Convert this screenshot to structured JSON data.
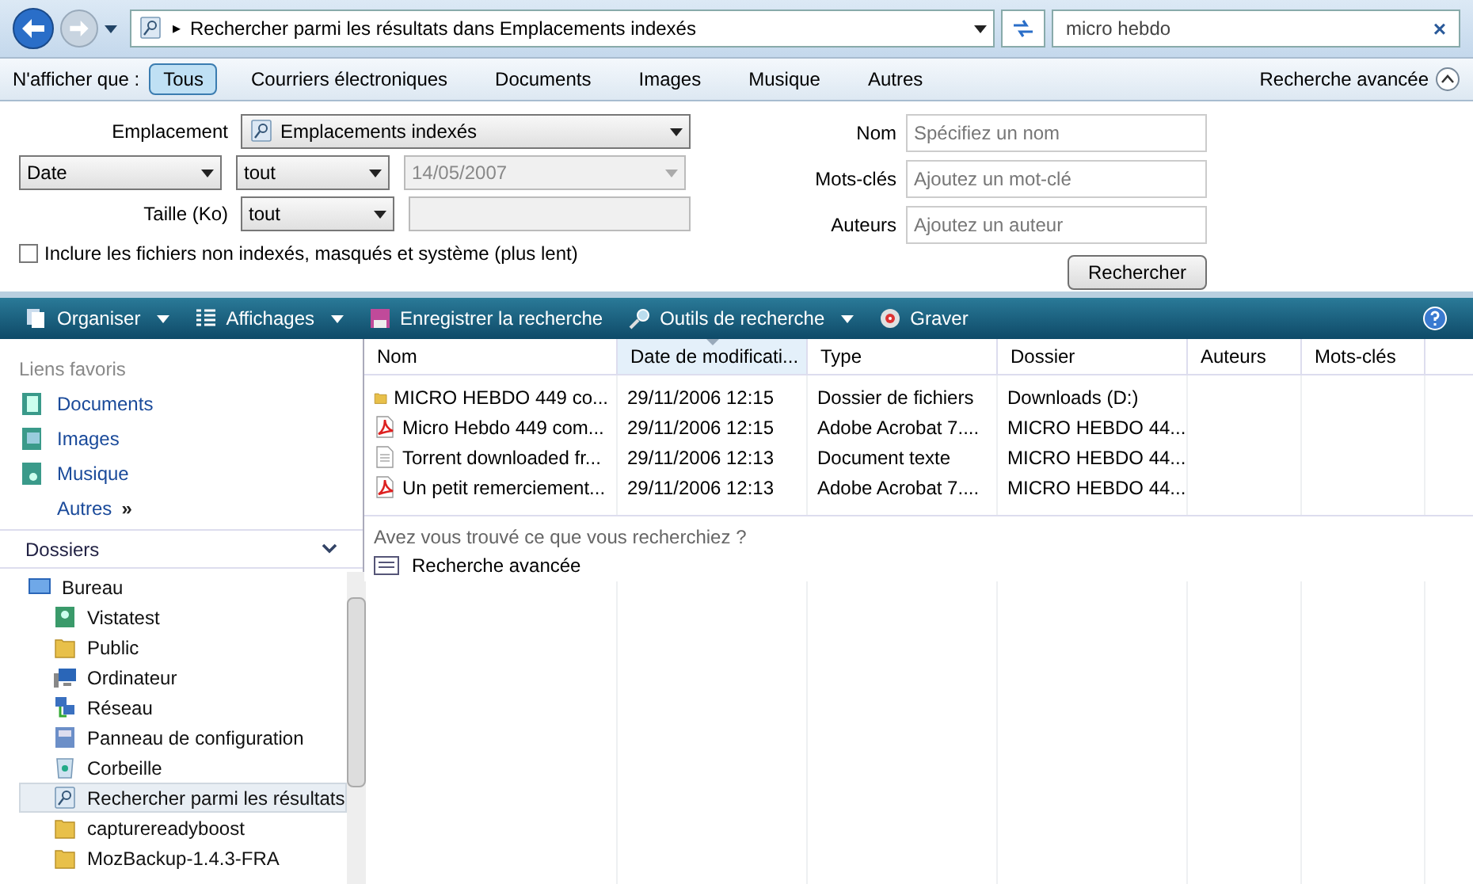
{
  "address_bar": {
    "path_arrow": "▸",
    "path": "Rechercher parmi les résultats dans Emplacements indexés",
    "search_value": "micro hebdo",
    "clear": "×"
  },
  "filter_bar": {
    "label": "N'afficher que :",
    "filters": [
      {
        "label": "Tous",
        "selected": true
      },
      {
        "label": "Courriers électroniques",
        "selected": false
      },
      {
        "label": "Documents",
        "selected": false
      },
      {
        "label": "Images",
        "selected": false
      },
      {
        "label": "Musique",
        "selected": false
      },
      {
        "label": "Autres",
        "selected": false
      }
    ],
    "advanced": "Recherche avancée"
  },
  "advanced_search": {
    "location_label": "Emplacement",
    "location": "Emplacements indexés",
    "date_field": "Date",
    "date_op": "tout",
    "date_value": "14/05/2007",
    "size_label": "Taille (Ko)",
    "size_op": "tout",
    "include_label": "Inclure les fichiers non indexés, masqués et système (plus lent)",
    "include_checked": false,
    "fields": [
      {
        "label": "Nom",
        "placeholder": "Spécifiez un nom"
      },
      {
        "label": "Mots-clés",
        "placeholder": "Ajoutez un mot-clé"
      },
      {
        "label": "Auteurs",
        "placeholder": "Ajoutez un auteur"
      }
    ],
    "search_button": "Rechercher"
  },
  "toolbar": [
    {
      "label": "Organiser",
      "kind": "organize",
      "dropdown": true
    },
    {
      "label": "Affichages",
      "kind": "views",
      "dropdown": true
    },
    {
      "label": "Enregistrer la recherche",
      "kind": "save",
      "dropdown": false
    },
    {
      "label": "Outils de recherche",
      "kind": "tools",
      "dropdown": true
    },
    {
      "label": "Graver",
      "kind": "burn",
      "dropdown": false
    }
  ],
  "sidebar": {
    "favorites_title": "Liens favoris",
    "favorites": [
      {
        "label": "Documents",
        "kind": "documents"
      },
      {
        "label": "Images",
        "kind": "images"
      },
      {
        "label": "Musique",
        "kind": "music"
      }
    ],
    "more": "Autres",
    "more_arrow": "»",
    "folders_title": "Dossiers",
    "tree": [
      {
        "label": "Bureau",
        "kind": "desktop",
        "selected": false,
        "children": [
          {
            "label": "Vistatest",
            "kind": "user",
            "selected": false
          },
          {
            "label": "Public",
            "kind": "folder",
            "selected": false
          },
          {
            "label": "Ordinateur",
            "kind": "computer",
            "selected": false
          },
          {
            "label": "Réseau",
            "kind": "network",
            "selected": false
          },
          {
            "label": "Panneau de configuration",
            "kind": "control",
            "selected": false
          },
          {
            "label": "Corbeille",
            "kind": "bin",
            "selected": false
          },
          {
            "label": "Rechercher parmi les résultats",
            "kind": "search",
            "selected": true
          },
          {
            "label": "capturereadyboost",
            "kind": "folder",
            "selected": false
          },
          {
            "label": "MozBackup-1.4.3-FRA",
            "kind": "folder",
            "selected": false
          }
        ]
      }
    ]
  },
  "table": {
    "columns": [
      {
        "label": "Nom",
        "sorted": false
      },
      {
        "label": "Date de modificati...",
        "sorted": true
      },
      {
        "label": "Type",
        "sorted": false
      },
      {
        "label": "Dossier",
        "sorted": false
      },
      {
        "label": "Auteurs",
        "sorted": false
      },
      {
        "label": "Mots-clés",
        "sorted": false
      }
    ],
    "rows": [
      {
        "kind": "folder",
        "cells": [
          "MICRO HEBDO 449 co...",
          "29/11/2006 12:15",
          "Dossier de fichiers",
          "Downloads (D:)"
        ]
      },
      {
        "kind": "pdf",
        "cells": [
          "Micro Hebdo 449 com...",
          "29/11/2006 12:15",
          "Adobe Acrobat 7....",
          "MICRO HEBDO 44..."
        ]
      },
      {
        "kind": "text",
        "cells": [
          "Torrent downloaded fr...",
          "29/11/2006 12:13",
          "Document texte",
          "MICRO HEBDO 44..."
        ]
      },
      {
        "kind": "pdf",
        "cells": [
          "Un petit remerciement...",
          "29/11/2006 12:13",
          "Adobe Acrobat 7....",
          "MICRO HEBDO 44..."
        ]
      }
    ],
    "question": "Avez vous trouvé ce que vous recherchiez ?",
    "advanced_link": "Recherche avancée"
  }
}
